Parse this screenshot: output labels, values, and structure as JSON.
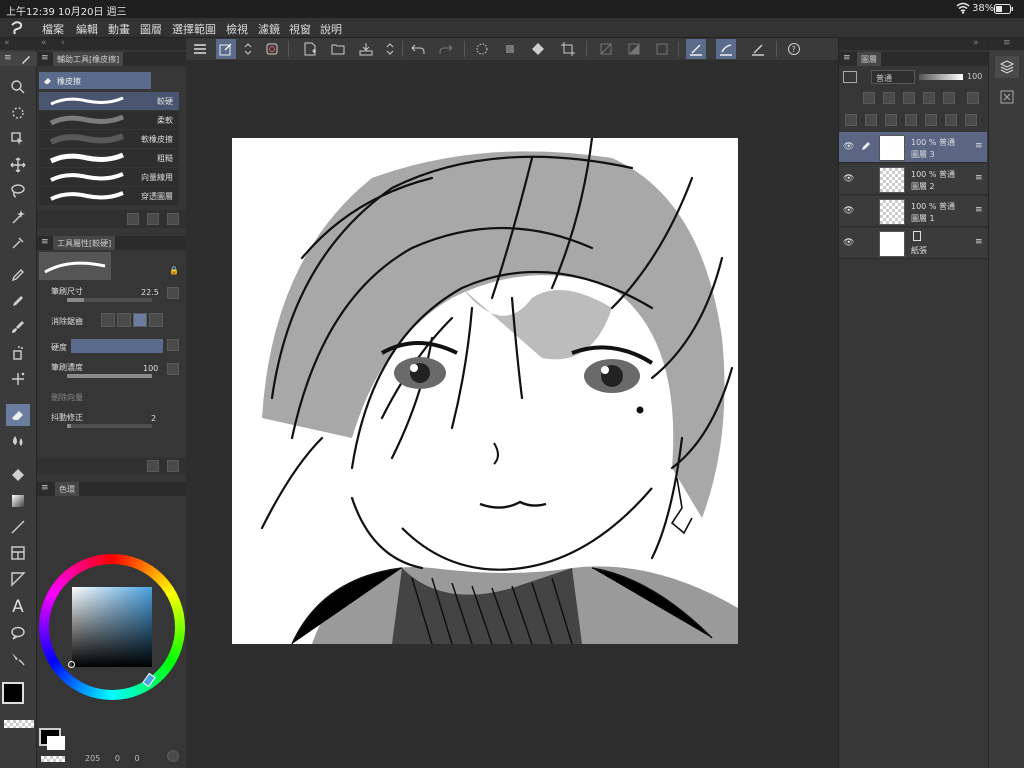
{
  "status": {
    "time": "上午12:39",
    "date": "10月20日 週三",
    "battery": "38%"
  },
  "menu": [
    "檔案",
    "編輯",
    "動畫",
    "圖層",
    "選擇範圍",
    "檢視",
    "濾鏡",
    "視窗",
    "說明"
  ],
  "subtool_panel": {
    "title": "輔助工具[橡皮擦]",
    "group": "橡皮擦",
    "brushes": [
      {
        "name": "較硬",
        "selected": true
      },
      {
        "name": "柔軟",
        "selected": false
      },
      {
        "name": "軟橡皮擦",
        "selected": false
      },
      {
        "name": "粗糙",
        "selected": false
      },
      {
        "name": "向量線用",
        "selected": false
      },
      {
        "name": "穿透圖層",
        "selected": false
      }
    ]
  },
  "tool_property": {
    "title": "工具屬性[較硬]",
    "brush_size_label": "筆刷尺寸",
    "brush_size_value": "22.5",
    "antialias_label": "消除鋸齒",
    "hardness_label": "硬度",
    "density_label": "筆刷濃度",
    "density_value": "100",
    "vector_erase_label": "刪除向量",
    "stabilization_label": "抖動修正",
    "stabilization_value": "2"
  },
  "color_panel": {
    "title": "色環",
    "main_color": "#000000",
    "sub_color": "#ffffff",
    "hue_color": "#4aa2e0"
  },
  "bottom_stats": {
    "a": "205",
    "b": "0",
    "c": "0"
  },
  "layer_panel": {
    "title": "圖層",
    "blend_mode": "普通",
    "opacity": "100",
    "layers": [
      {
        "opacity_mode": "100 % 普通",
        "name": "圖層 3",
        "selected": true
      },
      {
        "opacity_mode": "100 % 普通",
        "name": "圖層 2",
        "selected": false
      },
      {
        "opacity_mode": "100 % 普通",
        "name": "圖層 1",
        "selected": false
      },
      {
        "opacity_mode": "",
        "name": "紙張",
        "selected": false
      }
    ]
  }
}
